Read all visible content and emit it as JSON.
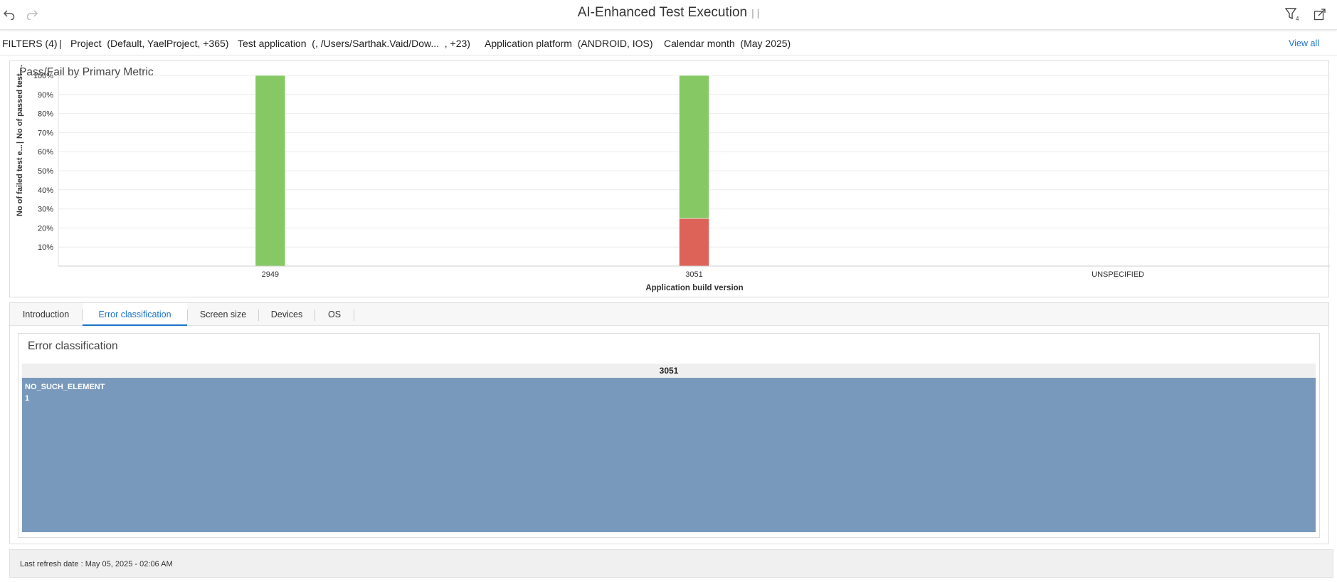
{
  "header": {
    "title": "AI-Enhanced Test Execution",
    "title_sep": "| |",
    "icons": {
      "undo": "undo-icon",
      "redo": "redo-icon",
      "filter": "filter-icon",
      "export": "export-icon"
    },
    "filter_count_badge": "4"
  },
  "filters": {
    "label": "FILTERS (4)",
    "sep": "|",
    "items": [
      {
        "name": "Project",
        "value": "(Default, YaelProject, +365)"
      },
      {
        "name": "Test application",
        "value": "(, /Users/Sarthak.Vaid/Dow...  , +23)"
      },
      {
        "name": "Application platform",
        "value": "(ANDROID, IOS)"
      },
      {
        "name": "Calendar month",
        "value": "(May 2025)"
      }
    ],
    "view_all": "View all"
  },
  "chart": {
    "title": "Pass/Fail by Primary Metric",
    "y_label_top": "No of passed test ...",
    "y_label_sep": "|",
    "y_label_bottom": "No of failed test e...",
    "xlabel": "Application build version",
    "colors": {
      "passed": "#86c964",
      "failed": "#dd6359",
      "grid": "#ececec"
    }
  },
  "chart_data": {
    "type": "bar",
    "stacked": true,
    "normalized_percent": true,
    "categories": [
      "2949",
      "3051",
      "UNSPECIFIED"
    ],
    "series": [
      {
        "name": "No of failed test e...",
        "values": [
          0,
          25,
          0
        ]
      },
      {
        "name": "No of passed test ...",
        "values": [
          100,
          75,
          0
        ]
      }
    ],
    "yticks": [
      "10%",
      "20%",
      "30%",
      "40%",
      "50%",
      "60%",
      "70%",
      "80%",
      "90%",
      "100%"
    ],
    "ylim": [
      0,
      100
    ],
    "xlabel": "Application build version",
    "ylabel": "No of passed test ... | No of failed test e...",
    "grid": true
  },
  "tabs": [
    {
      "label": "Introduction",
      "active": false
    },
    {
      "label": "Error classification",
      "active": true
    },
    {
      "label": "Screen size",
      "active": false
    },
    {
      "label": "Devices",
      "active": false
    },
    {
      "label": "OS",
      "active": false
    }
  ],
  "error_classification": {
    "title": "Error classification",
    "column": "3051",
    "cells": [
      {
        "label": "NO_SUCH_ELEMENT",
        "value": "1",
        "color": "#7899bb"
      }
    ]
  },
  "footer": {
    "text": "Last refresh date : May 05, 2025 - 02:06 AM"
  }
}
